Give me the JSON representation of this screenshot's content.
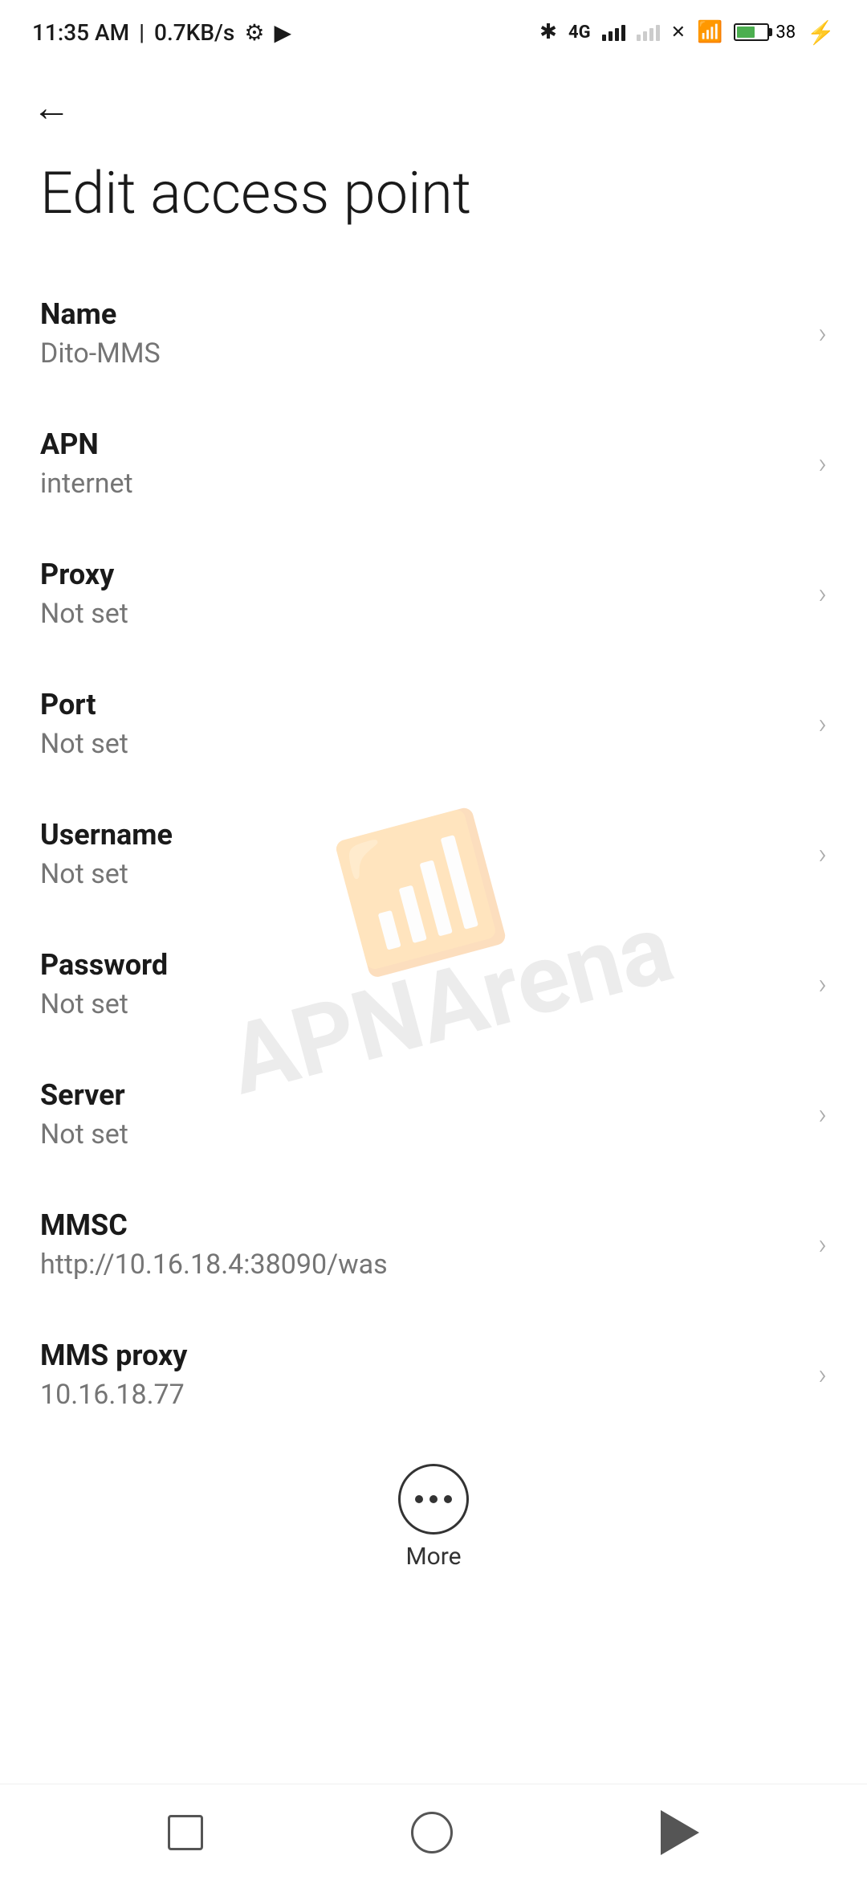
{
  "statusBar": {
    "time": "11:35 AM",
    "speed": "0.7KB/s"
  },
  "navigation": {
    "backArrow": "←"
  },
  "page": {
    "title": "Edit access point"
  },
  "settings": [
    {
      "label": "Name",
      "value": "Dito-MMS"
    },
    {
      "label": "APN",
      "value": "internet"
    },
    {
      "label": "Proxy",
      "value": "Not set"
    },
    {
      "label": "Port",
      "value": "Not set"
    },
    {
      "label": "Username",
      "value": "Not set"
    },
    {
      "label": "Password",
      "value": "Not set"
    },
    {
      "label": "Server",
      "value": "Not set"
    },
    {
      "label": "MMSC",
      "value": "http://10.16.18.4:38090/was"
    },
    {
      "label": "MMS proxy",
      "value": "10.16.18.77"
    }
  ],
  "more": {
    "label": "More"
  },
  "watermark": {
    "text": "APNArena"
  }
}
